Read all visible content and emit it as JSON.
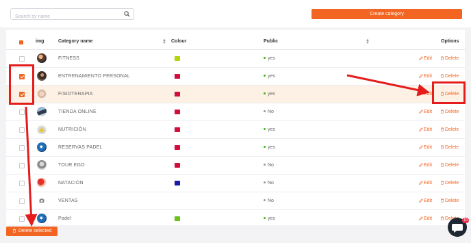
{
  "search": {
    "placeholder": "Search by name"
  },
  "toolbar": {
    "create_label": "Create category"
  },
  "table": {
    "headers": {
      "img": "img",
      "name": "Category name",
      "colour": "Colour",
      "public": "Public",
      "options": "Options"
    },
    "rows": [
      {
        "name": "FITNESS",
        "colour": "#b7d40a",
        "public": "yes",
        "public_dot": "#3fb618",
        "checked": false,
        "avatar": "fitness-photo"
      },
      {
        "name": "ENTRENAMIENTO PERSONAL",
        "colour": "#d0103a",
        "public": "yes",
        "public_dot": "#3fb618",
        "checked": true,
        "avatar": "personal-training-photo"
      },
      {
        "name": "FISIOTERAPIA",
        "colour": "#d0103a",
        "public": "yes",
        "public_dot": "#3fb618",
        "checked": true,
        "avatar": "physio-photo"
      },
      {
        "name": "TIENDA ONLINE",
        "colour": "#d0103a",
        "public": "No",
        "public_dot": "#999999",
        "checked": false,
        "avatar": "shop-photo"
      },
      {
        "name": "NUTRICIÓN",
        "colour": "#d0103a",
        "public": "yes",
        "public_dot": "#3fb618",
        "checked": false,
        "avatar": "nutrition-photo"
      },
      {
        "name": "RESERVAS PADEL",
        "colour": "#d0103a",
        "public": "yes",
        "public_dot": "#3fb618",
        "checked": false,
        "avatar": "padel-photo"
      },
      {
        "name": "TOUR EGO",
        "colour": "#d0103a",
        "public": "No",
        "public_dot": "#999999",
        "checked": false,
        "avatar": "tour-photo"
      },
      {
        "name": "NATACIÓN",
        "colour": "#1a1aa8",
        "public": "No",
        "public_dot": "#999999",
        "checked": false,
        "avatar": "swimming-photo"
      },
      {
        "name": "VENTAS",
        "colour": "",
        "public": "No",
        "public_dot": "#999999",
        "checked": false,
        "avatar": "camera-placeholder-icon"
      },
      {
        "name": "Padel",
        "colour": "#6cc11a",
        "public": "yes",
        "public_dot": "#3fb618",
        "checked": false,
        "avatar": "padel-photo"
      }
    ],
    "edit_label": "Edit",
    "delete_label": "Delete"
  },
  "footer": {
    "delete_selected_label": "Delete selected"
  },
  "chat": {
    "badge": "10"
  },
  "colors": {
    "accent": "#f26522",
    "annotation": "#e41c1c"
  }
}
